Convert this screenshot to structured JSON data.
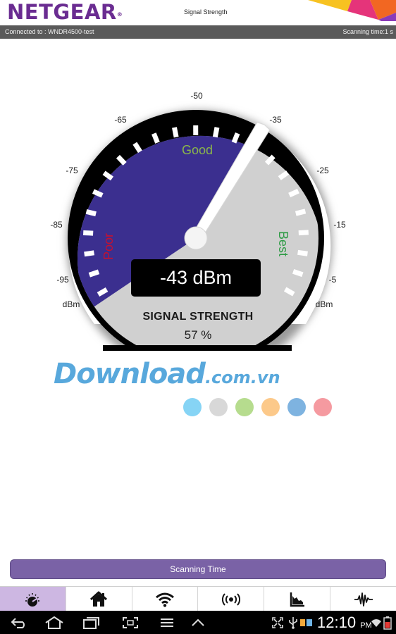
{
  "header": {
    "logo": "NETGEAR",
    "logo_mark": "®",
    "title": "Signal Strength",
    "brand_colors": [
      "#f7c221",
      "#e5347a",
      "#f26722",
      "#8a3ab9"
    ]
  },
  "status": {
    "connected": "Connected to : WNDR4500-test",
    "scanning_time": "Scanning time:1 s"
  },
  "gauge": {
    "scale_labels": [
      "-50",
      "-65",
      "-35",
      "-75",
      "-25",
      "-85",
      "-15",
      "-95",
      "-5",
      "dBm",
      "dBm"
    ],
    "zones": {
      "poor": "Poor",
      "good": "Good",
      "best": "Best"
    },
    "reading": "-43 dBm",
    "reading_value_dbm": -43,
    "title": "SIGNAL STRENGTH",
    "percent": "57 %",
    "percent_value": 57,
    "colors": {
      "weak_zone": "#3b2f8f",
      "strong_zone": "#d0d0d0",
      "poor": "#c8102e",
      "good": "#8ab64a",
      "best": "#2e9b45"
    }
  },
  "watermark": {
    "main": "Download",
    "tail": ".com.vn",
    "dot_colors": [
      "#86d4f5",
      "#d8d8d8",
      "#b6dc8e",
      "#fcc98a",
      "#7eb3e0",
      "#f59aa0"
    ]
  },
  "scan_button": {
    "label": "Scanning Time"
  },
  "tabs": [
    {
      "icon": "signal-gauge-icon",
      "active": true
    },
    {
      "icon": "home-icon",
      "active": false
    },
    {
      "icon": "wifi-icon",
      "active": false
    },
    {
      "icon": "broadcast-icon",
      "active": false
    },
    {
      "icon": "area-graph-icon",
      "active": false
    },
    {
      "icon": "waveform-icon",
      "active": false
    }
  ],
  "system_bar": {
    "time": "12:10",
    "ampm": "PM",
    "nav_icons": [
      "back-icon",
      "home-icon",
      "recent-apps-icon",
      "screenshot-icon",
      "menu-icon",
      "collapse-icon"
    ],
    "status_icons": [
      "fullscreen-icon",
      "usb-icon",
      "media-icon",
      "wifi-icon",
      "battery-icon"
    ]
  }
}
